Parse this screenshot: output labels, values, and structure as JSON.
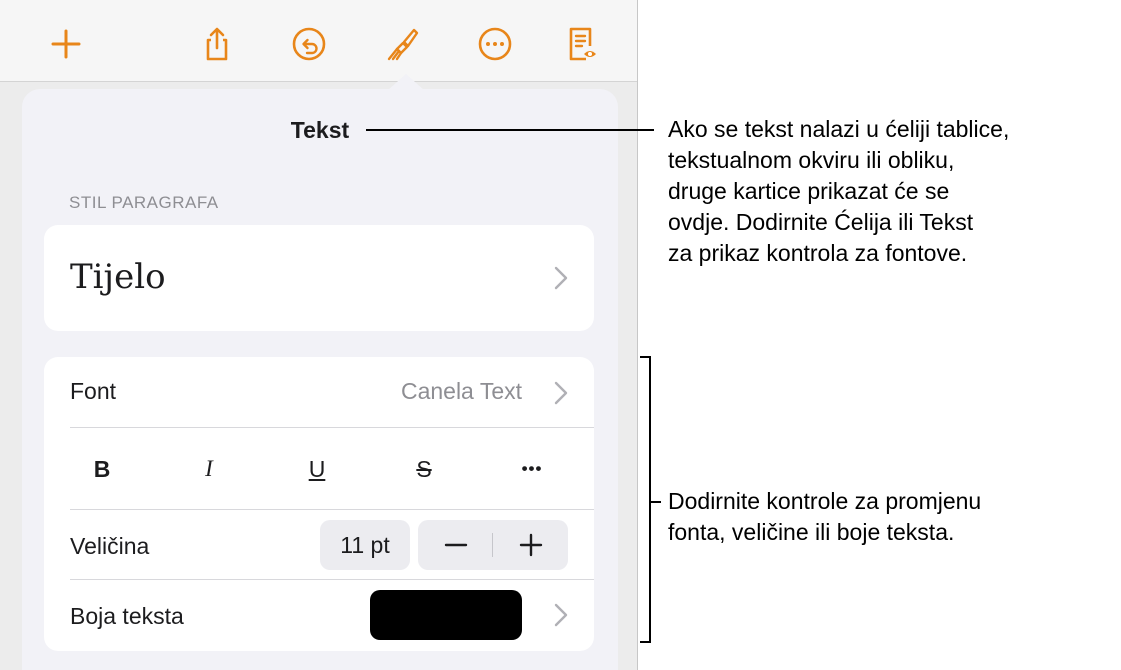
{
  "toolbar": {
    "icons": [
      "plus-icon",
      "share-icon",
      "undo-icon",
      "format-brush-icon",
      "more-icon",
      "reading-view-icon"
    ],
    "accent_color": "#e8861a"
  },
  "popover": {
    "title": "Tekst",
    "paragraph_style_label": "STIL PARAGRAFA",
    "paragraph_style_value": "Tijelo",
    "font_label": "Font",
    "font_value": "Canela Text",
    "format_buttons": {
      "bold": "B",
      "italic": "I",
      "underline": "U",
      "strikethrough": "S",
      "more": "•••"
    },
    "size_label": "Veličina",
    "size_value": "11 pt",
    "decrease_label": "−",
    "increase_label": "+",
    "text_color_label": "Boja teksta",
    "text_color_value": "#000000"
  },
  "callouts": {
    "tabs": "Ako se tekst nalazi u ćeliji tablice,\ntekstualnom okviru ili obliku,\ndruge kartice prikazat će se\novdje. Dodirnite Ćelija ili Tekst\nza prikaz kontrola za fontove.",
    "controls": "Dodirnite kontrole za promjenu\nfonta, veličine ili boje teksta."
  }
}
